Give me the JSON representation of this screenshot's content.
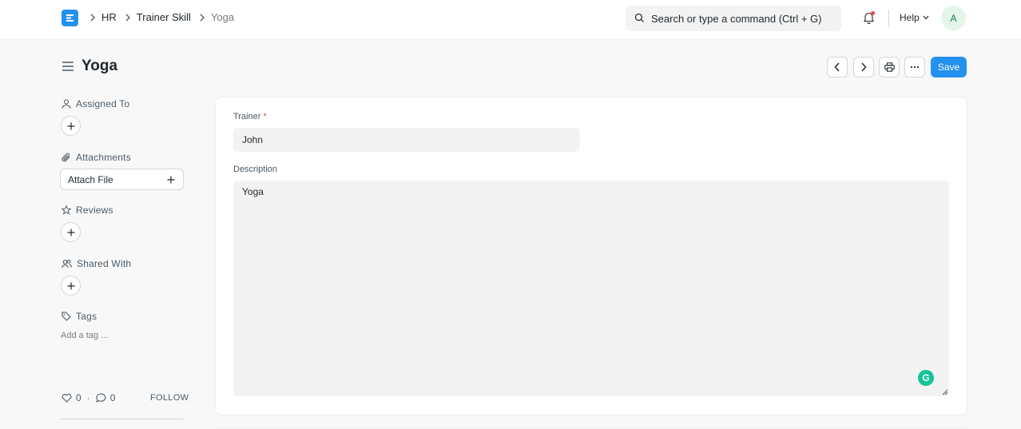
{
  "navbar": {
    "breadcrumbs": [
      "HR",
      "Trainer Skill",
      "Yoga"
    ],
    "search_placeholder": "Search or type a command (Ctrl + G)",
    "help_label": "Help",
    "avatar_initial": "A"
  },
  "page": {
    "title": "Yoga",
    "save_label": "Save"
  },
  "sidebar": {
    "assigned_to": "Assigned To",
    "attachments": "Attachments",
    "attach_file": "Attach File",
    "reviews": "Reviews",
    "shared_with": "Shared With",
    "tags": "Tags",
    "add_tag": "Add a tag ...",
    "likes": "0",
    "comments": "0",
    "follow": "FOLLOW"
  },
  "form": {
    "trainer_label": "Trainer",
    "trainer_required": "*",
    "trainer_value": "John",
    "description_label": "Description",
    "description_value": "Yoga"
  },
  "colors": {
    "primary": "#2490ef",
    "required": "#e24c4c",
    "grammarly": "#15c39a"
  }
}
